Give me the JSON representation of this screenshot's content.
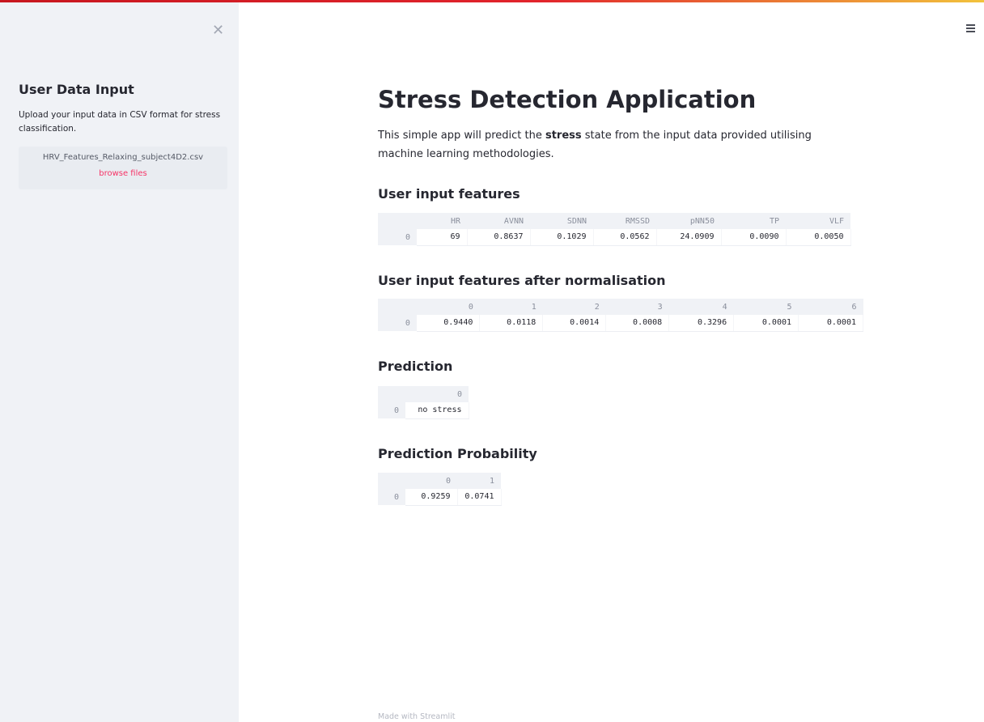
{
  "sidebar": {
    "close_glyph": "✕",
    "title": "User Data Input",
    "description": "Upload your input data in CSV format for stress classification.",
    "uploaded_file": "HRV_Features_Relaxing_subject4D2.csv",
    "browse_label": "browse files"
  },
  "header": {
    "menu_icon": "hamburger-menu-icon"
  },
  "main": {
    "title": "Stress Detection Application",
    "intro_before": "This simple app will predict the ",
    "intro_bold": "stress",
    "intro_after": " state from the input data provided utilising machine learning methodologies.",
    "sections": {
      "features": {
        "heading": "User input features",
        "columns": [
          "",
          "HR",
          "AVNN",
          "SDNN",
          "RMSSD",
          "pNN50",
          "TP",
          "VLF"
        ],
        "rows": [
          [
            "0",
            "69",
            "0.8637",
            "0.1029",
            "0.0562",
            "24.0909",
            "0.0090",
            "0.0050"
          ]
        ]
      },
      "normalised": {
        "heading": "User input features after normalisation",
        "columns": [
          "",
          "0",
          "1",
          "2",
          "3",
          "4",
          "5",
          "6"
        ],
        "rows": [
          [
            "0",
            "0.9440",
            "0.0118",
            "0.0014",
            "0.0008",
            "0.3296",
            "0.0001",
            "0.0001"
          ]
        ]
      },
      "prediction": {
        "heading": "Prediction",
        "columns": [
          "",
          "0"
        ],
        "rows": [
          [
            "0",
            "no stress"
          ]
        ]
      },
      "probability": {
        "heading": "Prediction Probability",
        "columns": [
          "",
          "0",
          "1"
        ],
        "rows": [
          [
            "0",
            "0.9259",
            "0.0741"
          ]
        ]
      }
    }
  },
  "footer": {
    "text": "Made with Streamlit"
  },
  "colors": {
    "accent": "#f63366",
    "sidebar_bg": "#f0f2f6",
    "text": "#262730"
  }
}
